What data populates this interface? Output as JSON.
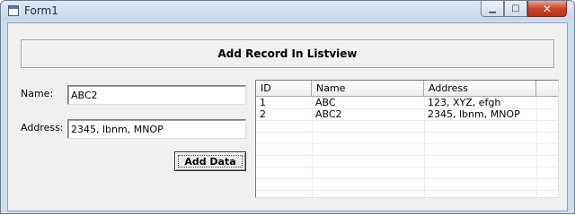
{
  "window": {
    "title": "Form1",
    "minimize_glyph": "▁",
    "maximize_glyph": "□",
    "close_glyph": "✕"
  },
  "form": {
    "header": "Add Record In Listview",
    "name_label": "Name:",
    "name_value": "ABC2",
    "address_label": "Address:",
    "address_value": "2345, lbnm, MNOP",
    "add_button_label": "Add Data"
  },
  "listview": {
    "columns": [
      "ID",
      "Name",
      "Address",
      ""
    ],
    "rows": [
      [
        "1",
        "ABC",
        "123, XYZ, efgh"
      ],
      [
        "2",
        "ABC2",
        "2345, lbnm, MNOP"
      ]
    ]
  },
  "icons": {
    "app": "app-window-icon",
    "minimize": "minimize-icon",
    "maximize": "maximize-icon",
    "close": "close-icon"
  },
  "colors": {
    "close_button": "#c7432b",
    "titlebar": "#cfdcec",
    "client_background": "#f0f0f0"
  }
}
